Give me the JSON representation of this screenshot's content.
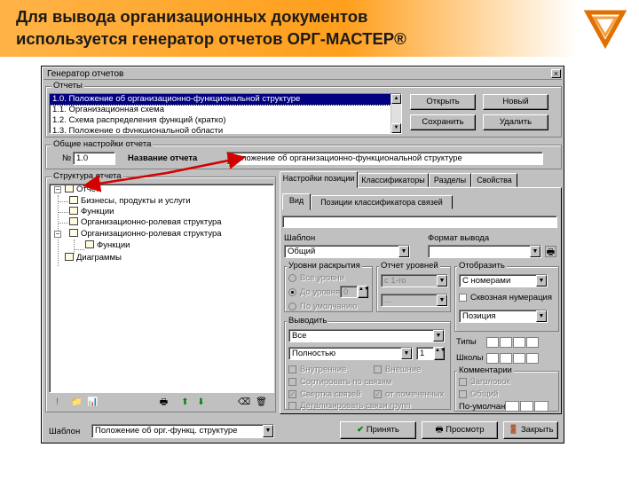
{
  "slide": {
    "title_line1": "Для вывода организационных документов",
    "title_line2": "используется генератор отчетов ОРГ-МАСТЕР®"
  },
  "dialog": {
    "title": "Генератор отчетов",
    "close_glyph": "×",
    "reports_group": "Отчеты",
    "reports": [
      "1.0. Положение об организационно-функциональной структуре",
      "1.1. Организационная схема",
      "1.2. Схема распределения функций (кратко)",
      "1.3. Положение о функциональной области"
    ],
    "btn_open": "Открыть",
    "btn_new": "Новый",
    "btn_save": "Сохранить",
    "btn_delete": "Удалить",
    "general_group": "Общие настройки отчета",
    "num_label": "№",
    "num_value": "1.0",
    "report_name_label": "Название отчета",
    "report_name_value": "Положение об организационно-функциональной структуре",
    "structure_group": "Структура отчета",
    "tree": {
      "root": "Отчет",
      "n1": "Бизнесы, продукты и услуги",
      "n2": "Функции",
      "n3": "Организационно-ролевая структура",
      "n4": "Организационно-ролевая структура",
      "n4a": "Функции",
      "n5": "Диаграммы"
    },
    "tabs": [
      "Настройки позиции",
      "Классификаторы",
      "Разделы",
      "Свойства"
    ],
    "subtabs": [
      "Вид",
      "Позиции классификатора связей"
    ],
    "template_label": "Шаблон",
    "template_value": "Общий",
    "output_format_label": "Формат вывода",
    "levels_group": "Уровни раскрытия",
    "levels_all": "Все уровни",
    "levels_to": "До уровня",
    "levels_to_value": "0",
    "levels_by_def": "По умолчанию",
    "report_levels_group": "Отчет уровней",
    "report_levels_value1": "с 1-го",
    "report_levels_value2": "...",
    "display_group": "Отобразить",
    "display_numbering": "С номерами",
    "display_through": "Сквозная нумерация",
    "display_position": "Позиция",
    "output_group": "Выводить",
    "output_value1": "Все",
    "output_value2": "Полностью",
    "output_value2_spin": "1",
    "chk_internal": "Внутренние",
    "chk_external": "Внешние",
    "chk_sort": "Сортировать по связям",
    "chk_collapse": "Свертка связей",
    "chk_marked": "от помеченных",
    "chk_detail": "Детализировать связи групп",
    "types_label": "Типы",
    "schools_label": "Школы",
    "comments_group": "Комментарии",
    "comment_header": "Заголовок",
    "comment_common": "Общий",
    "comment_default": "По-умолчанию",
    "bottom_template_label": "Шаблон",
    "bottom_template_value": "Положение об орг.-функц. структуре",
    "btn_apply": "Принять",
    "btn_view": "Просмотр",
    "btn_close": "Закрыть"
  },
  "icons": {
    "dropdown": "▼",
    "expand_minus": "−",
    "expand_plus": "+",
    "check": "✓",
    "spin": "▲▼",
    "warning": "!",
    "apply_check": "✔",
    "up_arrow": "⬆",
    "down_arrow": "⬇",
    "trash": "🗑",
    "folder": "📁",
    "chart": "📊",
    "printer": "🖶",
    "open_door": "🚪"
  },
  "colors": {
    "header_orange": "#ff9f1c",
    "selection": "#000080",
    "arrow_red": "#d40000"
  }
}
